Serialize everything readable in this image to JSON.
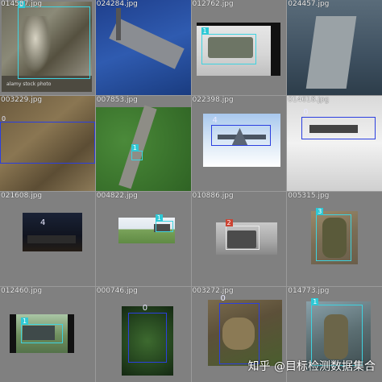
{
  "tiles": [
    {
      "filename": "014507.jpg",
      "class_id": "0"
    },
    {
      "filename": "024284.jpg"
    },
    {
      "filename": "012762.jpg",
      "class_id": "1"
    },
    {
      "filename": "024457.jpg"
    },
    {
      "filename": "003229.jpg",
      "class_id": "0"
    },
    {
      "filename": "007853.jpg",
      "class_id": "1"
    },
    {
      "filename": "022398.jpg",
      "class_id": "4"
    },
    {
      "filename": "014618.jpg",
      "class_id": "0"
    },
    {
      "filename": "021608.jpg",
      "class_id": "4"
    },
    {
      "filename": "004822.jpg",
      "class_id": "1"
    },
    {
      "filename": "010886.jpg",
      "class_id": "2"
    },
    {
      "filename": "005315.jpg",
      "class_id": "3"
    },
    {
      "filename": "012460.jpg",
      "class_id": "1"
    },
    {
      "filename": "000746.jpg",
      "class_id": "0"
    },
    {
      "filename": "003272.jpg",
      "class_id": "0"
    },
    {
      "filename": "014773.jpg",
      "class_id": "1"
    }
  ],
  "stock_caption": "alamy stock photo",
  "watermark": "知乎 @目标检测数据集合",
  "colors": {
    "cyan_box": "#3fd3e0",
    "blue_box": "#2b3fe0",
    "background": "#808080"
  }
}
